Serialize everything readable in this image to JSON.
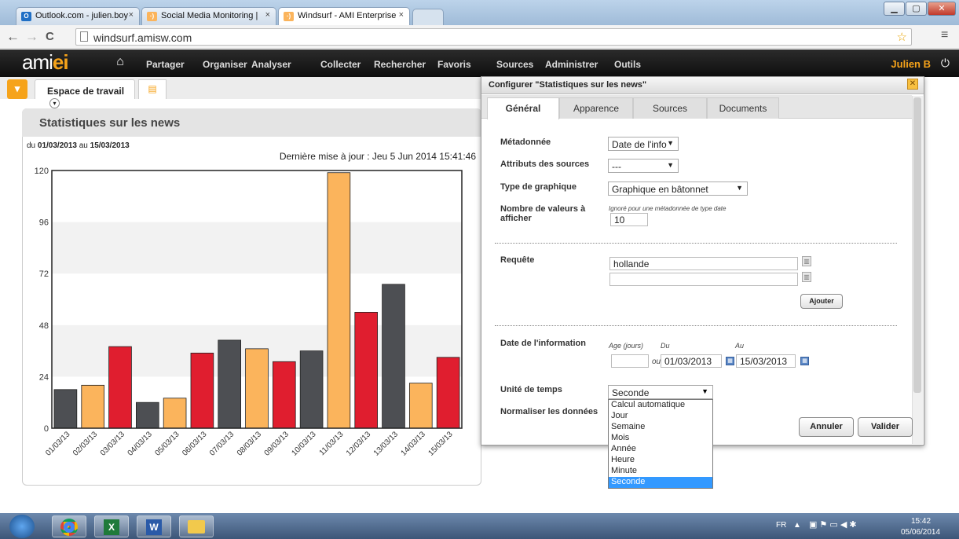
{
  "browser": {
    "tabs": [
      {
        "label": "Outlook.com - julien.boy",
        "icon": "outlook-icon"
      },
      {
        "label": "Social Media Monitoring |",
        "icon": "windsurf-icon"
      },
      {
        "label": "Windsurf - AMI Enterprise",
        "icon": "windsurf-icon"
      }
    ],
    "url": "windsurf.amisw.com"
  },
  "app": {
    "logo_main": "ami",
    "logo_accent": "ei",
    "nav": [
      "Partager",
      "Organiser",
      "Analyser",
      "Collecter",
      "Rechercher",
      "Favoris",
      "Sources",
      "Administrer",
      "Outils"
    ],
    "user": "Julien B"
  },
  "workspace": {
    "tab_label": "Espace de travail"
  },
  "widget": {
    "title": "Statistiques sur les news",
    "range_prefix": "du",
    "range_from": "01/03/2013",
    "range_mid": "au",
    "range_to": "15/03/2013",
    "updated": "Dernière mise à jour : Jeu 5 Jun 2014 15:41:46"
  },
  "chart_data": {
    "type": "bar",
    "categories": [
      "01/03/13",
      "02/03/13",
      "03/03/13",
      "04/03/13",
      "05/03/13",
      "06/03/13",
      "07/03/13",
      "08/03/13",
      "09/03/13",
      "10/03/13",
      "11/03/13",
      "12/03/13",
      "13/03/13",
      "14/03/13",
      "15/03/13"
    ],
    "values": [
      18,
      20,
      38,
      12,
      14,
      35,
      41,
      37,
      31,
      36,
      119,
      54,
      67,
      21,
      33
    ],
    "bar_colors": [
      "#4d4f53",
      "#fbb45c",
      "#e01e2f",
      "#4d4f53",
      "#fbb45c",
      "#e01e2f",
      "#4d4f53",
      "#fbb45c",
      "#e01e2f",
      "#4d4f53",
      "#fbb45c",
      "#e01e2f",
      "#4d4f53",
      "#fbb45c",
      "#e01e2f"
    ],
    "yticks": [
      "0",
      "24",
      "48",
      "72",
      "96",
      "120"
    ],
    "ylim": [
      0,
      120
    ],
    "grid": "horizontal bands"
  },
  "dialog": {
    "title": "Configurer \"Statistiques sur les news\"",
    "tabs": [
      "Général",
      "Apparence",
      "Sources",
      "Documents"
    ],
    "fields": {
      "metadata_label": "Métadonnée",
      "metadata_value": "Date de l'info",
      "source_attr_label": "Attributs des sources",
      "source_attr_value": "---",
      "chart_type_label": "Type de graphique",
      "chart_type_value": "Graphique en bâtonnet",
      "num_values_label": "Nombre de valeurs à afficher",
      "num_values_hint": "Ignoré pour une métadonnée de type date",
      "num_values_value": "10",
      "query_label": "Requête",
      "query_value": "hollande",
      "query_value2": "",
      "add_button": "Ajouter",
      "date_label": "Date de l'information",
      "age_hint": "Age (jours)",
      "from_hint": "Du",
      "to_hint": "Au",
      "or_text": "ou",
      "age_value": "",
      "date_from": "01/03/2013",
      "date_to": "15/03/2013",
      "time_unit_label": "Unité de temps",
      "time_unit_value": "Seconde",
      "normalize_label": "Normaliser les données",
      "time_unit_options": [
        "Calcul automatique",
        "Jour",
        "Semaine",
        "Mois",
        "Année",
        "Heure",
        "Minute",
        "Seconde"
      ],
      "time_unit_selected_index": 7
    },
    "cancel": "Annuler",
    "ok": "Valider"
  },
  "taskbar": {
    "lang": "FR",
    "time": "15:42",
    "date": "05/06/2014"
  }
}
